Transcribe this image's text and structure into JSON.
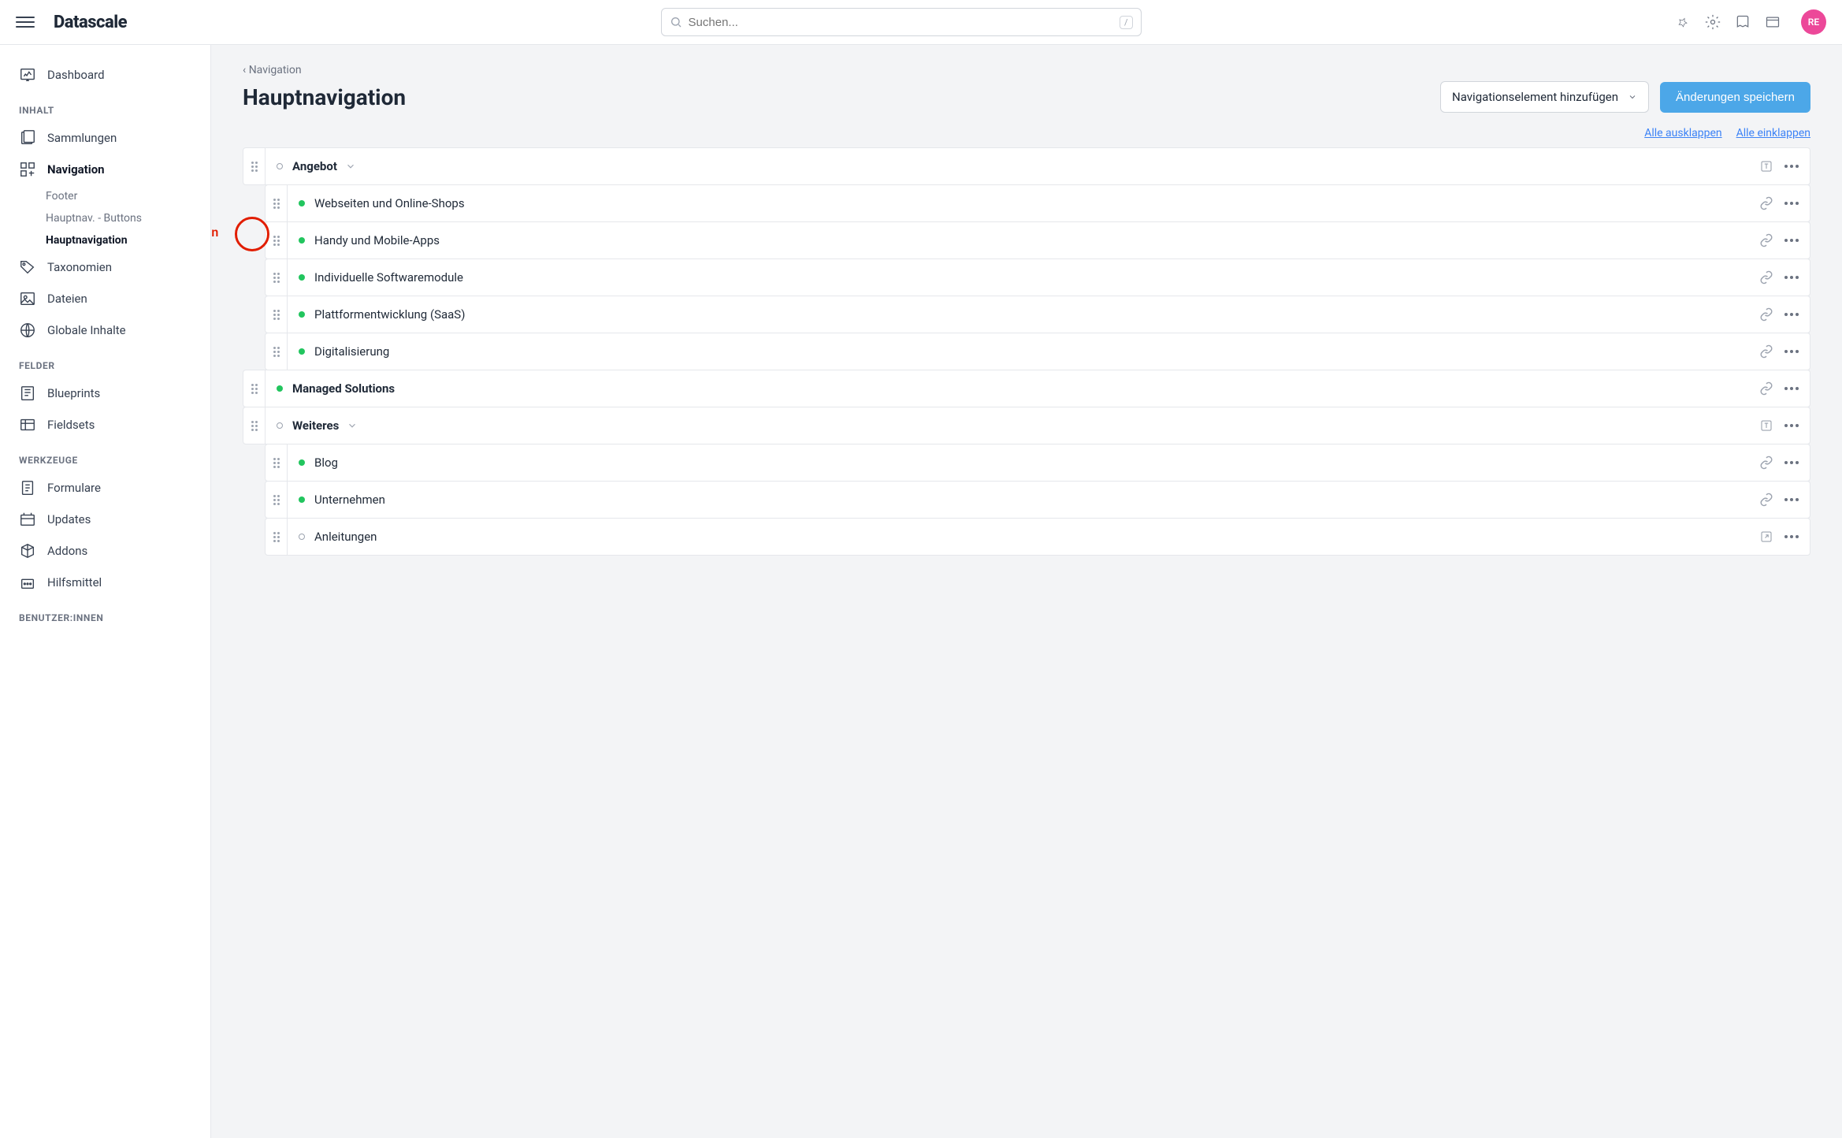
{
  "brand": "Datascale",
  "search": {
    "placeholder": "Suchen...",
    "kbd": "/"
  },
  "avatar": "RE",
  "sidebar": {
    "top": {
      "label": "Dashboard"
    },
    "sections": [
      {
        "title": "INHALT",
        "items": [
          {
            "label": "Sammlungen",
            "icon": "collections"
          },
          {
            "label": "Navigation",
            "icon": "navigation",
            "active": true,
            "children": [
              {
                "label": "Footer"
              },
              {
                "label": "Hauptnav. - Buttons"
              },
              {
                "label": "Hauptnavigation",
                "active": true
              }
            ]
          },
          {
            "label": "Taxonomien",
            "icon": "tag"
          },
          {
            "label": "Dateien",
            "icon": "image"
          },
          {
            "label": "Globale Inhalte",
            "icon": "globe"
          }
        ]
      },
      {
        "title": "FELDER",
        "items": [
          {
            "label": "Blueprints",
            "icon": "blueprint"
          },
          {
            "label": "Fieldsets",
            "icon": "fieldset"
          }
        ]
      },
      {
        "title": "WERKZEUGE",
        "items": [
          {
            "label": "Formulare",
            "icon": "form"
          },
          {
            "label": "Updates",
            "icon": "updates"
          },
          {
            "label": "Addons",
            "icon": "addons"
          },
          {
            "label": "Hilfsmittel",
            "icon": "tools"
          }
        ]
      },
      {
        "title": "BENUTZER:INNEN",
        "items": []
      }
    ]
  },
  "page": {
    "breadcrumb": "Navigation",
    "title": "Hauptnavigation",
    "add_button": "Navigationselement hinzufügen",
    "save_button": "Änderungen speichern",
    "expand_all": "Alle ausklappen",
    "collapse_all": "Alle einklappen"
  },
  "tree": [
    {
      "label": "Angebot",
      "level": 0,
      "status": "hollow",
      "bold": true,
      "expandable": true,
      "type_icon": "text"
    },
    {
      "label": "Webseiten und Online-Shops",
      "level": 1,
      "status": "green",
      "type_icon": "link"
    },
    {
      "label": "Handy und Mobile-Apps",
      "level": 1,
      "status": "green",
      "type_icon": "link"
    },
    {
      "label": "Individuelle Softwaremodule",
      "level": 1,
      "status": "green",
      "type_icon": "link"
    },
    {
      "label": "Plattformentwicklung (SaaS)",
      "level": 1,
      "status": "green",
      "type_icon": "link"
    },
    {
      "label": "Digitalisierung",
      "level": 1,
      "status": "green",
      "type_icon": "link"
    },
    {
      "label": "Managed Solutions",
      "level": 0,
      "status": "green",
      "bold": true,
      "type_icon": "link"
    },
    {
      "label": "Weiteres",
      "level": 0,
      "status": "hollow",
      "bold": true,
      "expandable": true,
      "type_icon": "text"
    },
    {
      "label": "Blog",
      "level": 1,
      "status": "green",
      "type_icon": "link"
    },
    {
      "label": "Unternehmen",
      "level": 1,
      "status": "green",
      "type_icon": "link"
    },
    {
      "label": "Anleitungen",
      "level": 1,
      "status": "hollow",
      "type_icon": "external"
    }
  ],
  "annotation": {
    "text": "Klick + ziehen"
  }
}
